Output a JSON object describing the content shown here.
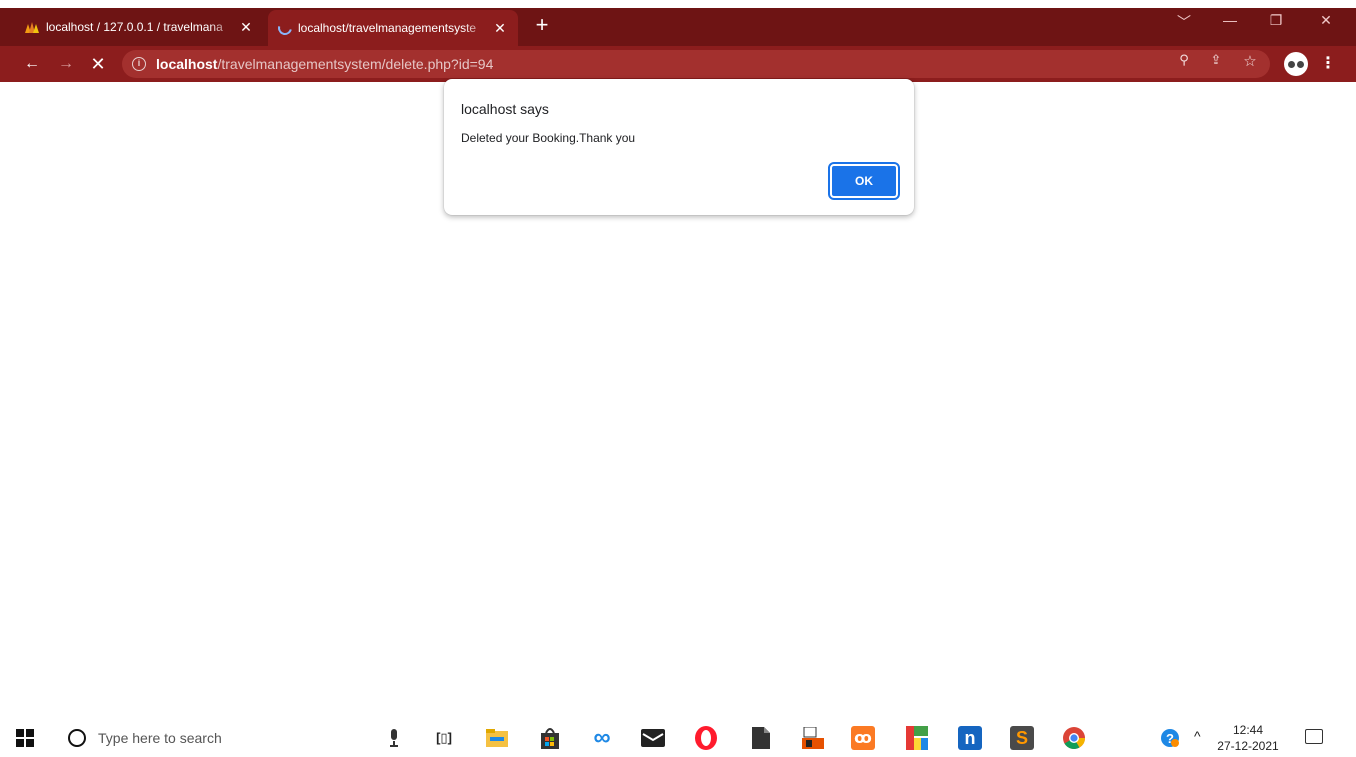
{
  "browser": {
    "tabs": [
      {
        "title": "localhost / 127.0.0.1 / travelmana",
        "active": false
      },
      {
        "title": "localhost/travelmanagementsyste",
        "active": true
      }
    ],
    "new_tab_label": "+",
    "url_host": "localhost",
    "url_path": "/travelmanagementsystem/delete.php?id=94"
  },
  "dialog": {
    "title": "localhost says",
    "message": "Deleted your Booking.Thank you",
    "ok_label": "OK"
  },
  "taskbar": {
    "search_placeholder": "Type here to search",
    "time": "12:44",
    "date": "27-12-2021"
  },
  "colors": {
    "tabstrip": "#6e1414",
    "toolbar": "#8c1d1d",
    "omnibox": "#a3302e",
    "dialog_button": "#1a73e8"
  }
}
